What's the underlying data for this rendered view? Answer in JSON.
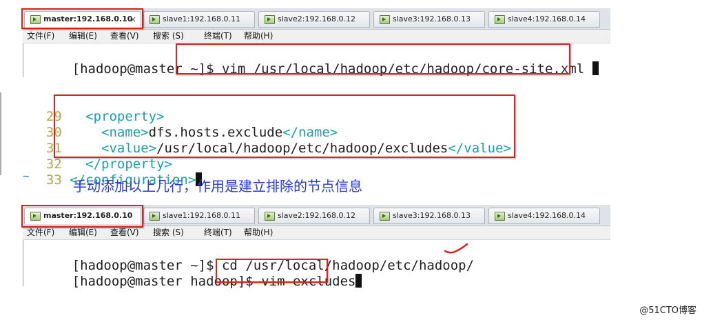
{
  "tabs": [
    {
      "label": "master:192.168.0.10",
      "active": true
    },
    {
      "label": "slave1:192.168.0.11",
      "active": false
    },
    {
      "label": "slave2:192.168.0.12",
      "active": false
    },
    {
      "label": "slave3:192.168.0.13",
      "active": false
    },
    {
      "label": "slave4:192.168.0.14",
      "active": false
    }
  ],
  "tab_close": "×",
  "menu": [
    "文件(F)",
    "编辑(E)",
    "查看(V)",
    "搜索 (S)",
    "终端(T)",
    "帮助(H)"
  ],
  "top_terminal": {
    "prompt": "[hadoop@master ~]$ ",
    "command": "vim /usr/local/hadoop/etc/hadoop/core-site.xml"
  },
  "editor": {
    "lines": [
      {
        "num": "29",
        "indent": "  ",
        "open": "<",
        "tag": "property",
        "close": ">",
        "text": "",
        "end_open": "",
        "end_tag": "",
        "end_close": ""
      },
      {
        "num": "30",
        "indent": "    ",
        "open": "<",
        "tag": "name",
        "close": ">",
        "text": "dfs.hosts.exclude",
        "end_open": "</",
        "end_tag": "name",
        "end_close": ">"
      },
      {
        "num": "31",
        "indent": "    ",
        "open": "<",
        "tag": "value",
        "close": ">",
        "text": "/usr/local/hadoop/etc/hadoop/excludes",
        "end_open": "</",
        "end_tag": "value",
        "end_close": ">"
      },
      {
        "num": "32",
        "indent": "  ",
        "open": "</",
        "tag": "property",
        "close": ">",
        "text": "",
        "end_open": "",
        "end_tag": "",
        "end_close": ""
      },
      {
        "num": "33",
        "indent": "",
        "open": "</",
        "tag": "configuration",
        "close": ">",
        "text": "",
        "end_open": "",
        "end_tag": "",
        "end_close": ""
      }
    ],
    "tilde": "~"
  },
  "annotation": "手动添加以上几行，作用是建立排除的节点信息",
  "bottom_terminal": {
    "line1_prompt": "[hadoop@master ~]$ ",
    "line1_command": "cd /usr/local/hadoop/etc/hadoop/",
    "line2_prompt": "[hadoop@master hadoop]$ ",
    "line2_command": "vim excludes"
  },
  "watermark": "@51CTO博客",
  "colors": {
    "highlight_box": "#e0201c",
    "xml_tag": "#1aa0a8",
    "line_number": "#b8a24a",
    "annotation": "#2a3bd6"
  }
}
